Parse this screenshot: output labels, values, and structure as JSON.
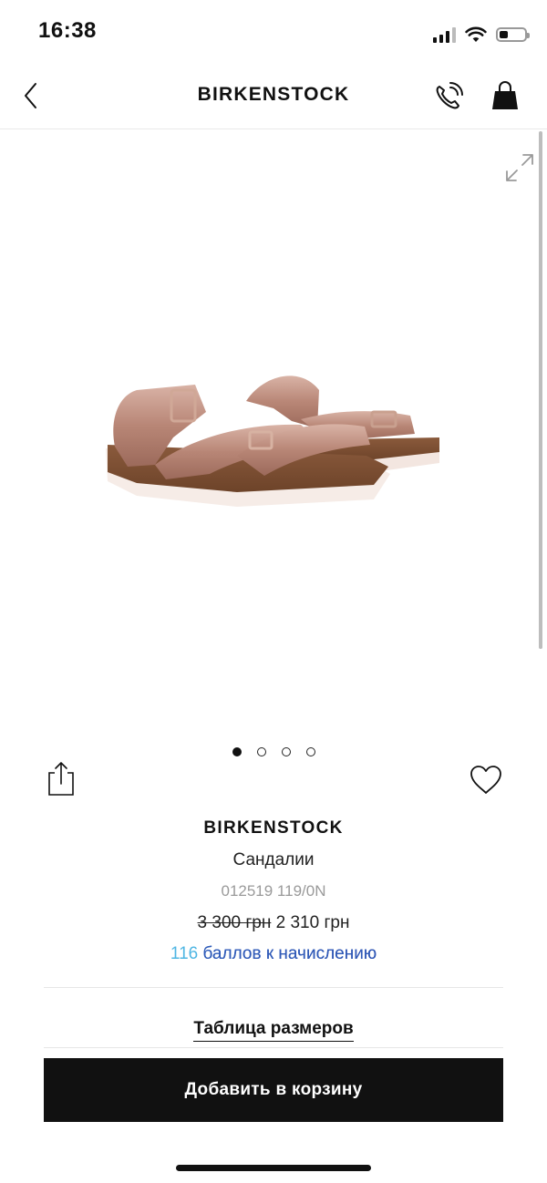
{
  "status_bar": {
    "time": "16:38"
  },
  "navbar": {
    "title": "BIRKENSTOCK"
  },
  "gallery": {
    "slides_count": 4,
    "active_slide": 1
  },
  "product": {
    "brand": "BIRKENSTOCK",
    "name": "Сандалии",
    "sku": "012519 119/0N",
    "price_old": "3 300 грн",
    "price_new": "2 310 грн",
    "points_value": "116",
    "points_text": "баллов к начислению"
  },
  "size_table": {
    "label": "Таблица размеров"
  },
  "cart_button": {
    "label": "Добавить в корзину"
  },
  "colors": {
    "accent_cyan": "#4fb6e3",
    "accent_blue": "#2f5ab8",
    "button_bg": "#111111"
  }
}
